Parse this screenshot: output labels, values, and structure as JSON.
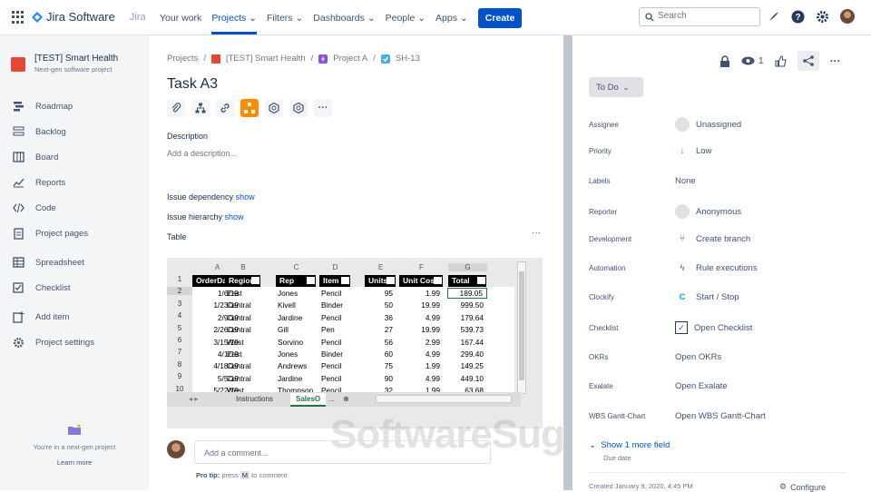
{
  "topbar": {
    "brand": "Jira Software",
    "brand_sub": "Jira",
    "nav": [
      "Your work",
      "Projects",
      "Filters",
      "Dashboards",
      "People",
      "Apps"
    ],
    "create_label": "Create",
    "search_placeholder": "Search"
  },
  "sidebar": {
    "project_name": "[TEST] Smart Health",
    "project_type": "Next-gen software project",
    "items": [
      "Roadmap",
      "Backlog",
      "Board",
      "Reports",
      "Code",
      "Project pages",
      "Spreadsheet",
      "Checklist",
      "Add item",
      "Project settings"
    ],
    "nextgen_text": "You're in a next-gen project",
    "learn_more": "Learn more"
  },
  "issue": {
    "breadcrumb": [
      "Projects",
      "[TEST] Smart Health",
      "Project A",
      "SH-13"
    ],
    "title": "Task A3",
    "description_label": "Description",
    "description_placeholder": "Add a description...",
    "dependency_label": "Issue dependency",
    "hierarchy_label": "Issue hierarchy",
    "show": "show",
    "table_label": "Table",
    "comment_placeholder": "Add a comment...",
    "protip_a": "Pro tip:",
    "protip_b": "press",
    "protip_key": "M",
    "protip_c": "to comment"
  },
  "spreadsheet": {
    "col_letters": [
      "A",
      "B",
      "C",
      "D",
      "E",
      "F",
      "G"
    ],
    "row_numbers": [
      "1",
      "2",
      "3",
      "4",
      "5",
      "6",
      "7",
      "8",
      "9",
      "10"
    ],
    "headers": [
      "OrderDa",
      "Region",
      "Rep",
      "Item",
      "Units",
      "Unit Cost",
      "Total"
    ],
    "rows": [
      [
        "1/6/19",
        "East",
        "Jones",
        "Pencil",
        "95",
        "1.99",
        "189.05"
      ],
      [
        "1/23/19",
        "Central",
        "Kivell",
        "Binder",
        "50",
        "19.99",
        "999.50"
      ],
      [
        "2/9/19",
        "Central",
        "Jardine",
        "Pencil",
        "36",
        "4.99",
        "179.64"
      ],
      [
        "2/26/19",
        "Central",
        "Gill",
        "Pen",
        "27",
        "19.99",
        "539.73"
      ],
      [
        "3/15/19",
        "West",
        "Sorvino",
        "Pencil",
        "56",
        "2.99",
        "167.44"
      ],
      [
        "4/1/19",
        "East",
        "Jones",
        "Binder",
        "60",
        "4.99",
        "299.40"
      ],
      [
        "4/18/19",
        "Central",
        "Andrews",
        "Pencil",
        "75",
        "1.99",
        "149.25"
      ],
      [
        "5/5/19",
        "Central",
        "Jardine",
        "Pencil",
        "90",
        "4.99",
        "449.10"
      ],
      [
        "5/22/19",
        "West",
        "Thompson",
        "Pencil",
        "32",
        "1.99",
        "63.68"
      ]
    ],
    "tabs": [
      "Instructions",
      "SalesO",
      "..."
    ]
  },
  "details": {
    "status": "To Do",
    "watch_count": "1",
    "fields": [
      {
        "key": "Assignee",
        "value": "Unassigned"
      },
      {
        "key": "Priority",
        "value": "Low"
      },
      {
        "key": "Labels",
        "value": "None"
      },
      {
        "key": "Reporter",
        "value": "Anonymous"
      },
      {
        "key": "Development",
        "value": "Create branch"
      },
      {
        "key": "Automation",
        "value": "Rule executions"
      },
      {
        "key": "Clockify",
        "value": "Start / Stop"
      },
      {
        "key": "Checklist",
        "value": "Open Checklist"
      },
      {
        "key": "OKRs",
        "value": "Open OKRs"
      },
      {
        "key": "Exalate",
        "value": "Open Exalate"
      },
      {
        "key": "WBS Gantt-Chart",
        "value": "Open WBS Gantt-Chart"
      }
    ],
    "show_more": "Show 1 more field",
    "show_more_sub": "Due date",
    "created": "Created January 9, 2020, 4:45 PM",
    "configure": "Configure"
  },
  "watermark": "SoftwareSuggest.com",
  "colors": {
    "accent": "#0052cc",
    "text": "#172b4d"
  }
}
